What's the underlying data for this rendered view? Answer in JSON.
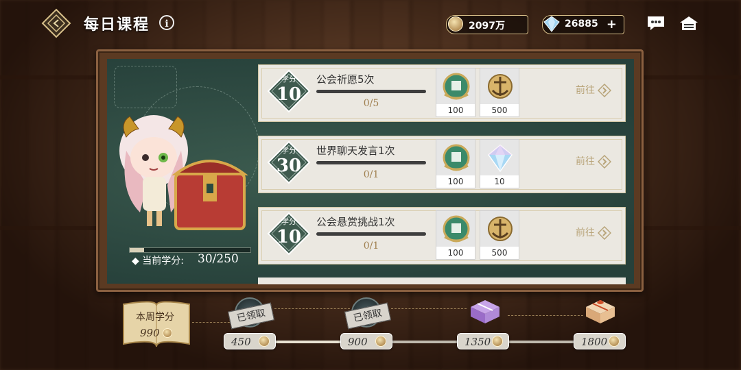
{
  "header": {
    "title": "每日课程",
    "gold_amount": "2097万",
    "gem_amount": "26885"
  },
  "left_panel": {
    "credits_label": "当前学分:",
    "credits_value": "30/250",
    "credits_progress": 0.12
  },
  "badge_label": "学分",
  "goto_label": "前往",
  "tasks": [
    {
      "credits": "10",
      "name": "公会祈愿5次",
      "progress": "0/5",
      "rewards": [
        {
          "icon": "guild-emblem-icon",
          "qty": "100"
        },
        {
          "icon": "anchor-emblem-icon",
          "qty": "500"
        }
      ]
    },
    {
      "credits": "30",
      "name": "世界聊天发言1次",
      "progress": "0/1",
      "rewards": [
        {
          "icon": "guild-emblem-icon",
          "qty": "100"
        },
        {
          "icon": "gem-icon",
          "qty": "10"
        }
      ]
    },
    {
      "credits": "10",
      "name": "公会悬赏挑战1次",
      "progress": "0/1",
      "rewards": [
        {
          "icon": "guild-emblem-icon",
          "qty": "100"
        },
        {
          "icon": "anchor-emblem-icon",
          "qty": "500"
        }
      ]
    }
  ],
  "weekly": {
    "label": "本周学分",
    "value": "990",
    "milestones": [
      {
        "value": "450",
        "status": "已领取"
      },
      {
        "value": "900",
        "status": "已领取"
      },
      {
        "value": "1350",
        "status": ""
      },
      {
        "value": "1800",
        "status": ""
      }
    ]
  },
  "colors": {
    "board": "#2f4a40",
    "card": "#ebe8e1",
    "accent": "#b8a479",
    "badge": "#3e5a4e"
  }
}
